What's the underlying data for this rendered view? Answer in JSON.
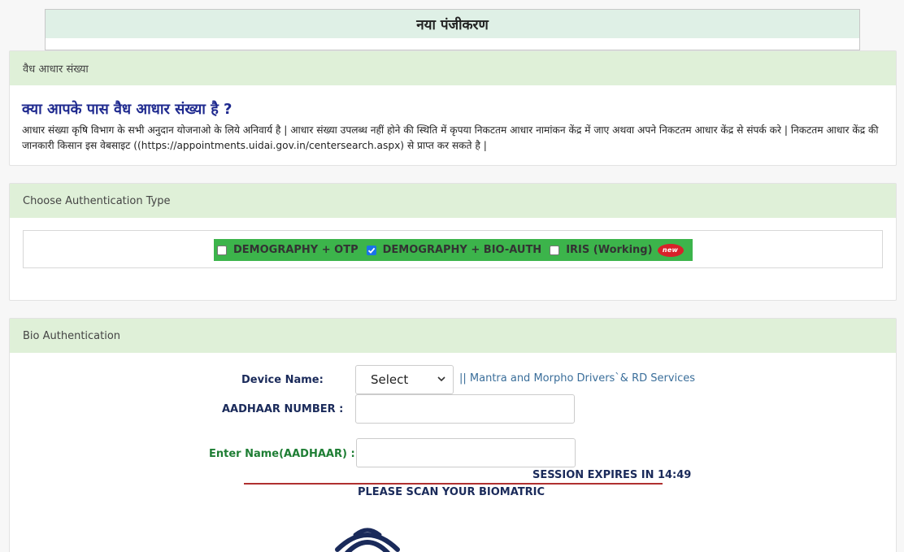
{
  "page": {
    "title": "नया पंजीकरण"
  },
  "aadhaar_card": {
    "header": "वैध आधार संख्या",
    "question": "क्या आपके पास वैध आधार संख्या है ?",
    "info": "आधार संख्या कृषि विभाग के सभी अनुदान योजनाओ के लिये अनिवार्य है | आधार संख्या उपलब्ध नहीं होने की स्थिति में कृपया निकटतम आधार नामांकन केंद्र में जाए अथवा अपने निकटतम आधार केंद्र से संपर्क करे | निकटतम आधार केंद्र की जानकारी किसान इस वेबसाइट ((https://appointments.uidai.gov.in/centersearch.aspx) से प्राप्त कर सकते है |"
  },
  "auth_type": {
    "header": "Choose Authentication Type",
    "options": [
      {
        "label": "DEMOGRAPHY + OTP",
        "checked": false
      },
      {
        "label": "DEMOGRAPHY + BIO-AUTH",
        "checked": true
      },
      {
        "label": "IRIS (Working)",
        "checked": false
      }
    ],
    "new_badge": "new",
    "bar_color": "#3cb44b"
  },
  "bio_auth": {
    "header": "Bio Authentication",
    "device_label": "Device Name:",
    "device_selected": "Select",
    "driver_link": "|| Mantra and Morpho Drivers`& RD Services",
    "aadhaar_label": "AADHAAR NUMBER :",
    "aadhaar_value": "",
    "name_label": "Enter Name(AADHAAR) :",
    "name_value": "",
    "session_text": "SESSION EXPIRES IN 14:49",
    "scan_text": "PLEASE SCAN YOUR BIOMATRIC",
    "fingerprint_icon": "fingerprint-icon"
  }
}
